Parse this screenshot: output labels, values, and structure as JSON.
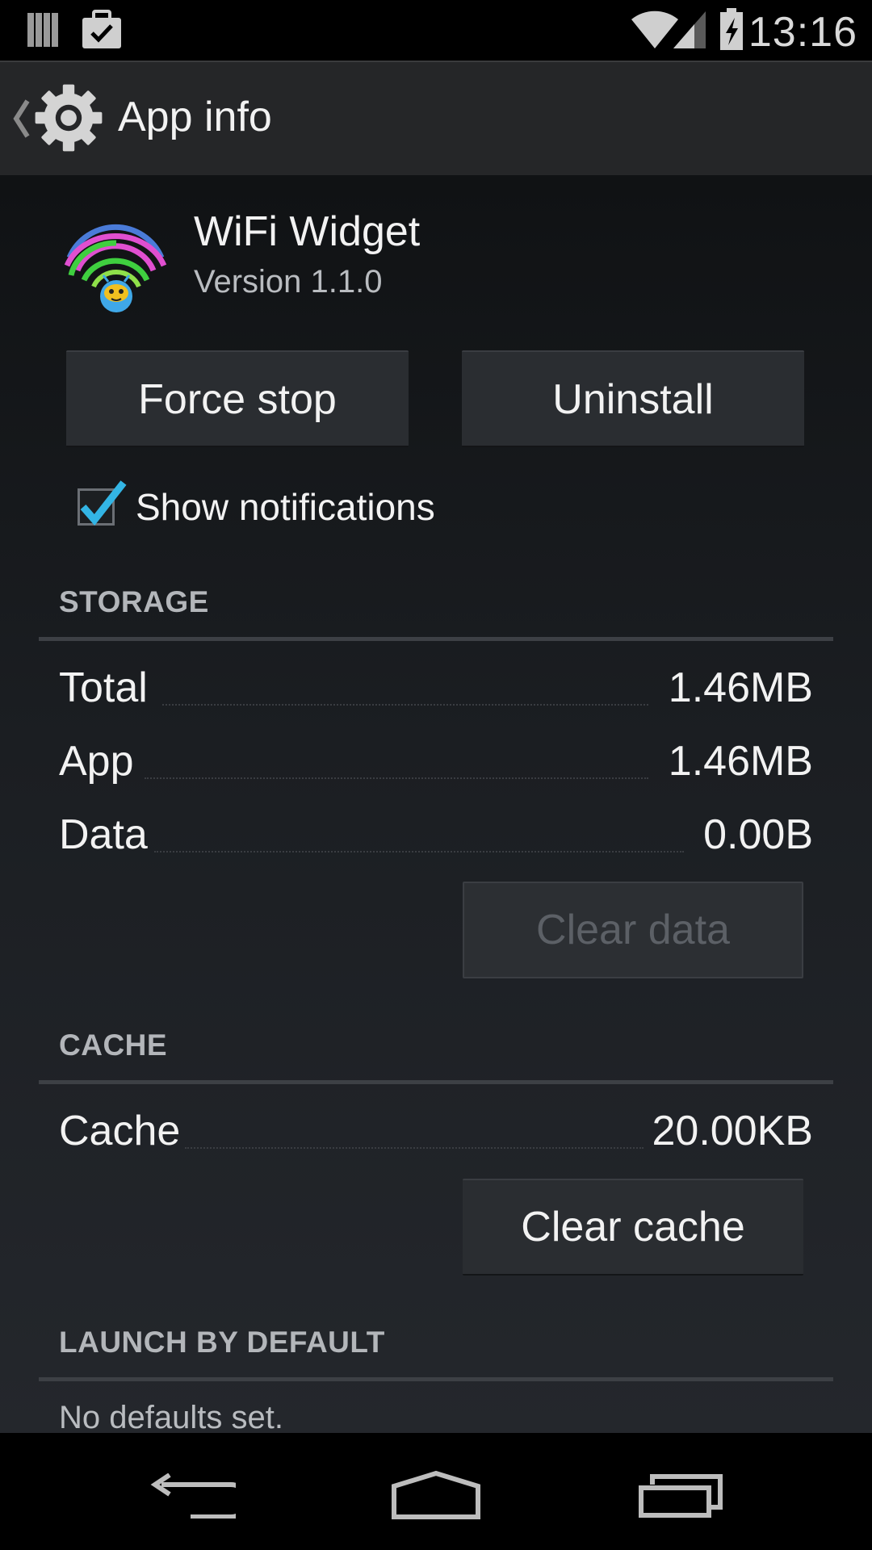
{
  "status_bar": {
    "time": "13:16",
    "icons": [
      "sim-cards-icon",
      "briefcase-check-icon",
      "wifi-icon",
      "cell-signal-icon",
      "battery-charging-icon"
    ]
  },
  "action_bar": {
    "title": "App info",
    "icons": [
      "back-chevron-icon",
      "gear-icon"
    ]
  },
  "app": {
    "name": "WiFi Widget",
    "version": "Version 1.1.0",
    "icon": "wifi-widget-app-icon"
  },
  "buttons": {
    "force_stop": "Force stop",
    "uninstall": "Uninstall",
    "clear_data": "Clear data",
    "clear_cache": "Clear cache"
  },
  "notifications": {
    "label": "Show notifications",
    "checked": true
  },
  "storage": {
    "header": "STORAGE",
    "rows": [
      {
        "label": "Total",
        "value": "1.46MB"
      },
      {
        "label": "App",
        "value": "1.46MB"
      },
      {
        "label": "Data",
        "value": "0.00B"
      }
    ]
  },
  "cache": {
    "header": "CACHE",
    "rows": [
      {
        "label": "Cache",
        "value": "20.00KB"
      }
    ]
  },
  "launch_by_default": {
    "header": "LAUNCH BY DEFAULT",
    "text": "No defaults set."
  },
  "nav_bar": {
    "icons": [
      "back-icon",
      "home-icon",
      "recent-apps-icon"
    ]
  },
  "colors": {
    "accent_blue": "#33b5e5",
    "action_bar_bg": "#252628",
    "disabled_text": "#5c6066"
  }
}
